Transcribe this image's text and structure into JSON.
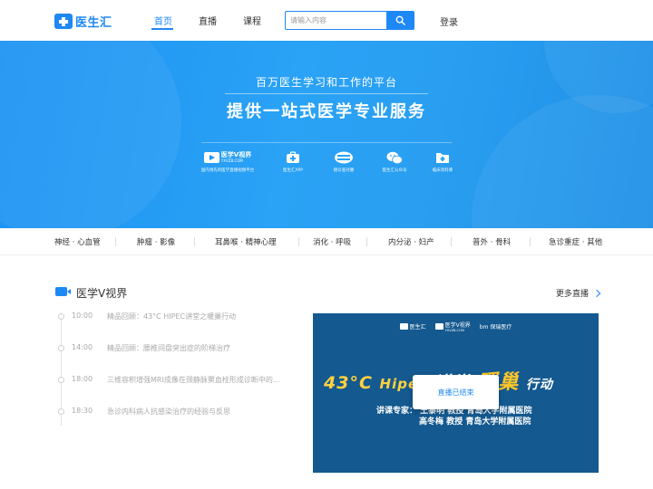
{
  "header": {
    "logo_text": "医生汇",
    "nav": [
      {
        "label": "首页",
        "active": true
      },
      {
        "label": "直播",
        "active": false
      },
      {
        "label": "课程",
        "active": false
      }
    ],
    "search_placeholder": "请输入内容",
    "login_label": "登录"
  },
  "hero": {
    "subtitle": "百万医生学习和工作的平台",
    "title": "提供一站式医学专业服务",
    "brand_main": "医学V视界",
    "brand_url": "YXVZB.COM",
    "brand_caption": "国内领先的医学直播视频平台",
    "items": [
      {
        "icon": "medical-kit-icon",
        "caption": "医生汇APP"
      },
      {
        "icon": "ahuizhu-logo-icon",
        "caption": "随诊查对腰"
      },
      {
        "icon": "wechat-icon",
        "caption": "医生汇公众号"
      },
      {
        "icon": "folder-plus-icon",
        "caption": "临床资料库"
      }
    ]
  },
  "categories": [
    "神经 · 心血管",
    "肿瘤 · 影像",
    "耳鼻喉 · 精神心理",
    "消化 · 呼吸",
    "内分泌 · 妇产",
    "普外 · 骨科",
    "急诊重症 · 其他"
  ],
  "section": {
    "title": "医学V视界",
    "more_label": "更多直播",
    "schedule": [
      {
        "time": "10:00",
        "title": "精品回顾：43°C HIPEC讲堂之暖巢行动"
      },
      {
        "time": "14:00",
        "title": "精品回顾：腰椎间盘突出症的阶梯治疗"
      },
      {
        "time": "18:00",
        "title": "三维容积增强MRI成像在颈静脉窦血栓形成诊断中的..."
      },
      {
        "time": "18:30",
        "title": "急诊内科病人抗感染治疗的经验与反思"
      }
    ]
  },
  "poster": {
    "logos": [
      "医生汇",
      "医学V视界",
      "bm 保瑞医疗"
    ],
    "logo_sub": "YXVZB.COM",
    "headline_a": "43°C",
    "headline_b": "Hipec",
    "headline_c": "讲堂",
    "headline_d": "暖巢",
    "headline_e": "行动",
    "speakers_label": "讲课专家：",
    "speakers": [
      {
        "name": "王黎明",
        "title": "教授",
        "org": "青岛大学附属医院"
      },
      {
        "name": "高冬梅",
        "title": "教授",
        "org": "青岛大学附属医院"
      }
    ],
    "status": "直播已结束"
  },
  "colors": {
    "brand": "#1e88f5",
    "hero": "#2aa2f5",
    "poster_bg": "#14598f",
    "accent_yellow": "#ffd23f"
  }
}
